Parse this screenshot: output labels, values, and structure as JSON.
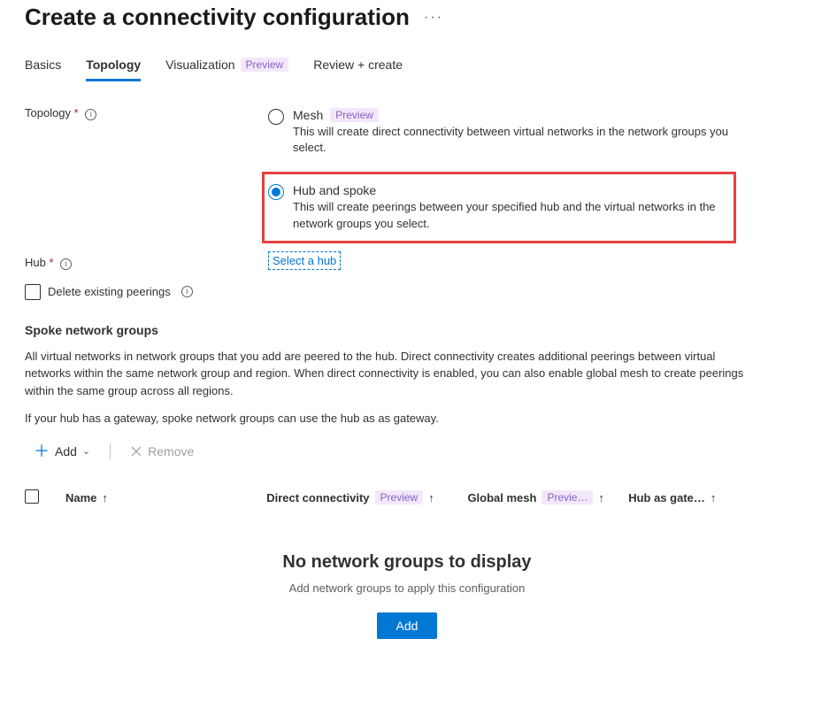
{
  "title": "Create a connectivity configuration",
  "tabs": [
    {
      "label": "Basics",
      "active": false,
      "badge": null
    },
    {
      "label": "Topology",
      "active": true,
      "badge": null
    },
    {
      "label": "Visualization",
      "active": false,
      "badge": "Preview"
    },
    {
      "label": "Review + create",
      "active": false,
      "badge": null
    }
  ],
  "form": {
    "topology": {
      "label": "Topology",
      "options": [
        {
          "title": "Mesh",
          "badge": "Preview",
          "selected": false,
          "desc": "This will create direct connectivity between virtual networks in the network groups you select."
        },
        {
          "title": "Hub and spoke",
          "badge": null,
          "selected": true,
          "desc": "This will create peerings between your specified hub and the virtual networks in the network groups you select."
        }
      ]
    },
    "hub": {
      "label": "Hub",
      "link": "Select a hub"
    },
    "delete_peerings": {
      "label": "Delete existing peerings",
      "checked": false
    }
  },
  "spoke": {
    "heading": "Spoke network groups",
    "desc1": "All virtual networks in network groups that you add are peered to the hub. Direct connectivity creates additional peerings between virtual networks within the same network group and region. When direct connectivity is enabled, you can also enable global mesh to create peerings within the same group across all regions.",
    "desc2": "If your hub has a gateway, spoke network groups can use the hub as as gateway."
  },
  "toolbar": {
    "add": "Add",
    "remove": "Remove"
  },
  "columns": [
    {
      "label": "Name",
      "badge": null
    },
    {
      "label": "Direct connectivity",
      "badge": "Preview"
    },
    {
      "label": "Global mesh",
      "badge": "Previe…"
    },
    {
      "label": "Hub as gate…",
      "badge": null
    }
  ],
  "empty": {
    "heading": "No network groups to display",
    "subtext": "Add network groups to apply this configuration",
    "button": "Add"
  }
}
